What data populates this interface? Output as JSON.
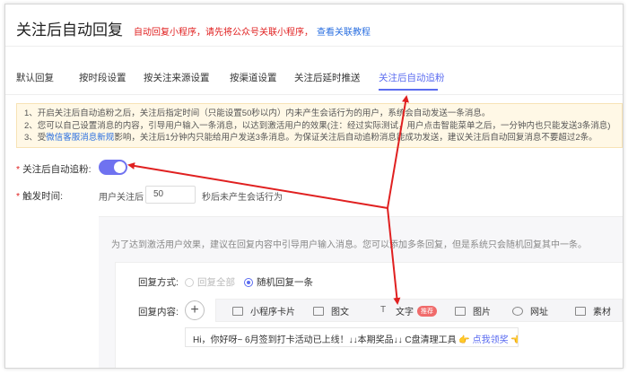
{
  "header": {
    "title": "关注后自动回复",
    "hint": "自动回复小程序，请先将公众号关联小程序，",
    "hint_link": "查看关联教程"
  },
  "tabs": [
    {
      "label": "默认回复",
      "active": false
    },
    {
      "label": "按时段设置",
      "active": false
    },
    {
      "label": "按关注来源设置",
      "active": false
    },
    {
      "label": "按渠道设置",
      "active": false
    },
    {
      "label": "关注后延时推送",
      "active": false
    },
    {
      "label": "关注后自动追粉",
      "active": true
    }
  ],
  "notice": {
    "line1": "1、开启关注后自动追粉之后，关注后指定时间（只能设置50秒以内）内未产生会话行为的用户，系统会自动发送一条消息。",
    "line2": "2、您可以自己设置消息的内容，引导用户输入一条消息，以达到激活用户的效果(注：经过实际测试，用户点击智能菜单之后，一分钟内也只能发送3条消息)",
    "line3_prefix": "3、受",
    "line3_link": "微信客服消息新规",
    "line3_suffix": "影响，关注后1分钟内只能给用户发送3条消息。为保证关注后自动追粉消息能成功发送，建议关注后自动回复消息不要超过2条。"
  },
  "auto_follow": {
    "label": "关注后自动追粉:",
    "enabled": true
  },
  "trigger": {
    "label": "触发时间:",
    "prefix": "用户关注后",
    "seconds": "50",
    "suffix": "秒后未产生会话行为"
  },
  "panel": {
    "tip": "为了达到激活用户效果，建议在回复内容中引导用户输入消息。您可以添加多条回复，但是系统只会随机回复其中一条。",
    "reply_mode_label": "回复方式:",
    "reply_mode_options": [
      {
        "label": "回复全部",
        "checked": false,
        "disabled": true
      },
      {
        "label": "随机回复一条",
        "checked": true,
        "disabled": false
      }
    ],
    "content_label": "回复内容:",
    "add_symbol": "+",
    "tools": [
      {
        "icon": "mini-program-icon",
        "label": "小程序卡片"
      },
      {
        "icon": "image-text-icon",
        "label": "图文"
      },
      {
        "icon": "text-icon",
        "label": "文字",
        "badge": "推荐"
      },
      {
        "icon": "image-icon",
        "label": "图片"
      },
      {
        "icon": "link-icon",
        "label": "网址"
      },
      {
        "icon": "material-icon",
        "label": "素材"
      }
    ],
    "content_text": "Hi，你好呀~ 6月签到打卡活动已上线！↓↓本期奖品↓↓ C盘清理工具",
    "content_link": "点我领奖",
    "content_emoji_left": "👉",
    "content_emoji_right": "👈"
  },
  "colors": {
    "accent": "#5b6cf0",
    "required": "#e02020",
    "arrow": "#e02020",
    "notice_bg": "#fff8e6"
  }
}
